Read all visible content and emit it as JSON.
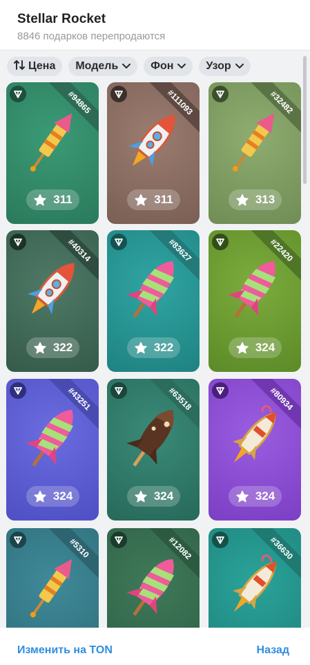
{
  "header": {
    "title": "Stellar Rocket",
    "subtitle": "8846 подарков перепродаются"
  },
  "filters": [
    {
      "label": "Цена",
      "icon": "sort-icon"
    },
    {
      "label": "Модель",
      "icon": "chevron-down-icon"
    },
    {
      "label": "Фон",
      "icon": "chevron-down-icon"
    },
    {
      "label": "Узор",
      "icon": "chevron-down-icon"
    }
  ],
  "gifts": [
    {
      "id": "#94865",
      "price": "311",
      "bg": "#3b9a76",
      "bg2": "#2a7a5c",
      "ribbon": "#2d6b56",
      "ton": "#1e4f3f",
      "model": "firework"
    },
    {
      "id": "#111093",
      "price": "311",
      "bg": "#9b7c70",
      "bg2": "#7a5f55",
      "ribbon": "#5e4a42",
      "ton": "#3d2f2a",
      "model": "rocket"
    },
    {
      "id": "#32482",
      "price": "313",
      "bg": "#8fac70",
      "bg2": "#6f8d55",
      "ribbon": "#5b7445",
      "ton": "#3c4f2c",
      "model": "firework"
    },
    {
      "id": "#40314",
      "price": "322",
      "bg": "#4f7a66",
      "bg2": "#355a4a",
      "ribbon": "#2e4c3f",
      "ton": "#1c3328",
      "model": "rocket"
    },
    {
      "id": "#83627",
      "price": "322",
      "bg": "#2fa5a3",
      "bg2": "#1f8281",
      "ribbon": "#237a78",
      "ton": "#155352",
      "model": "candy"
    },
    {
      "id": "#22420",
      "price": "324",
      "bg": "#7cac3d",
      "bg2": "#5c8a28",
      "ribbon": "#4f7627",
      "ton": "#334e18",
      "model": "candy"
    },
    {
      "id": "#43251",
      "price": "324",
      "bg": "#6b6ce0",
      "bg2": "#4f4fc4",
      "ribbon": "#4a4bb0",
      "ton": "#2e2f7f",
      "model": "candy"
    },
    {
      "id": "#63518",
      "price": "324",
      "bg": "#3a8a78",
      "bg2": "#27695a",
      "ribbon": "#2b6c5d",
      "ton": "#1a463c",
      "model": "choco"
    },
    {
      "id": "#80934",
      "price": "324",
      "bg": "#9b5de0",
      "bg2": "#7b3fc4",
      "ribbon": "#7037b0",
      "ton": "#4a1f7d",
      "model": "space"
    },
    {
      "id": "#5310",
      "price": "",
      "bg": "#3f8a99",
      "bg2": "#2e6c78",
      "ribbon": "#2d6470",
      "ton": "#1b444d",
      "model": "firework"
    },
    {
      "id": "#12082",
      "price": "",
      "bg": "#3f7a5a",
      "bg2": "#2e5e44",
      "ribbon": "#2b5a41",
      "ton": "#1a3c2a",
      "model": "candy"
    },
    {
      "id": "#36630",
      "price": "",
      "bg": "#2aa39a",
      "bg2": "#1e827a",
      "ribbon": "#1f7a72",
      "ton": "#145249",
      "model": "space"
    }
  ],
  "footer": {
    "left": "Изменить на TON",
    "right": "Назад"
  }
}
